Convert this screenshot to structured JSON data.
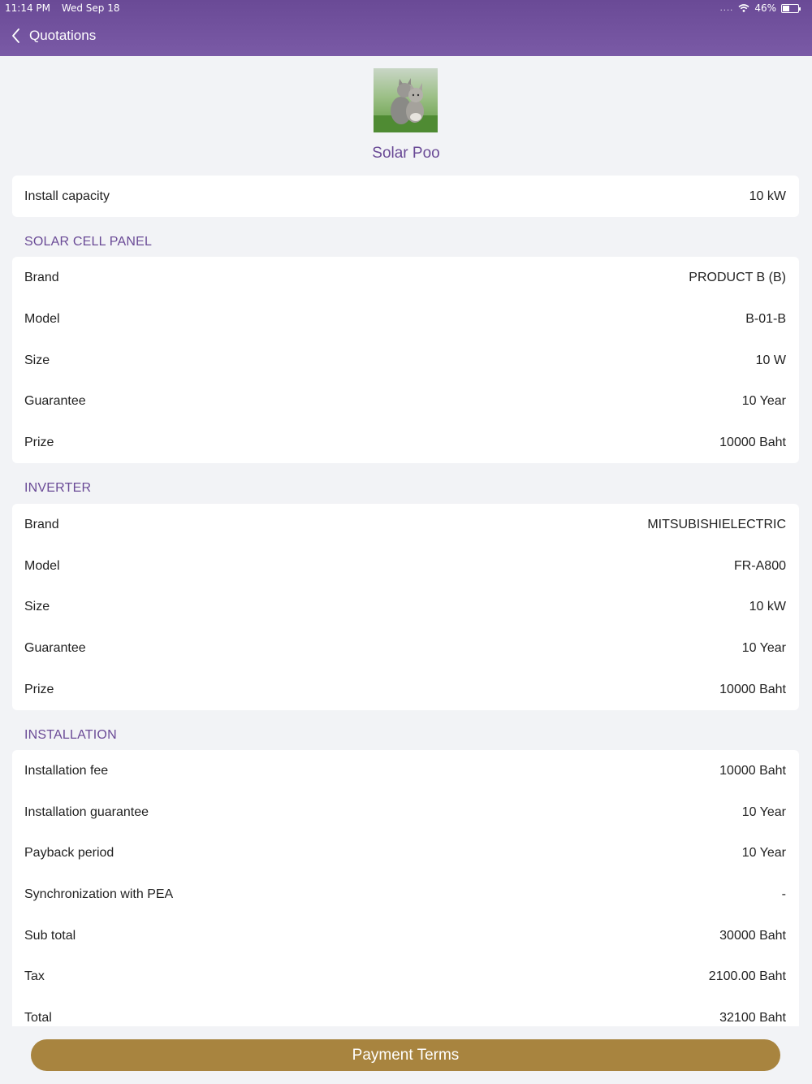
{
  "status_bar": {
    "time": "11:14 PM",
    "date": "Wed Sep 18",
    "signal": "....",
    "battery": "46%",
    "battery_level": 0.46
  },
  "nav": {
    "back_label": "Quotations"
  },
  "product": {
    "name": "Solar Poo",
    "image": "kittens-photo"
  },
  "summary": [
    {
      "label": "Install capacity",
      "value": "10 kW"
    }
  ],
  "sections": [
    {
      "title": "SOLAR CELL PANEL",
      "rows": [
        {
          "label": "Brand",
          "value": "PRODUCT B (B)"
        },
        {
          "label": "Model",
          "value": "B-01-B"
        },
        {
          "label": "Size",
          "value": "10 W"
        },
        {
          "label": "Guarantee",
          "value": "10 Year"
        },
        {
          "label": "Prize",
          "value": "10000 Baht"
        }
      ]
    },
    {
      "title": "INVERTER",
      "rows": [
        {
          "label": "Brand",
          "value": "MITSUBISHIELECTRIC"
        },
        {
          "label": "Model",
          "value": "FR-A800"
        },
        {
          "label": "Size",
          "value": "10 kW"
        },
        {
          "label": "Guarantee",
          "value": "10 Year"
        },
        {
          "label": "Prize",
          "value": "10000 Baht"
        }
      ]
    },
    {
      "title": "INSTALLATION",
      "rows": [
        {
          "label": "Installation fee",
          "value": "10000 Baht"
        },
        {
          "label": "Installation guarantee",
          "value": "10 Year"
        },
        {
          "label": "Payback period",
          "value": "10 Year"
        },
        {
          "label": "Synchronization with PEA",
          "value": "-"
        },
        {
          "label": "Sub total",
          "value": "30000 Baht"
        },
        {
          "label": "Tax",
          "value": "2100.00 Baht"
        },
        {
          "label": "Total",
          "value": "32100 Baht"
        }
      ]
    }
  ],
  "footer": {
    "button_label": "Payment Terms",
    "button_color": "#a8843f"
  },
  "colors": {
    "header": "#6a4a96",
    "accent": "#6a4a96",
    "background": "#f2f3f6"
  }
}
